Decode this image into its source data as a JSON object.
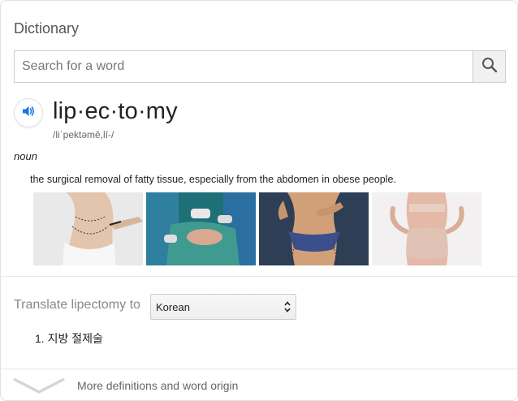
{
  "dictionary": {
    "title": "Dictionary",
    "search": {
      "placeholder": "Search for a word",
      "value": ""
    },
    "icons": {
      "search": "search-icon",
      "speaker": "speaker-icon",
      "expand": "chevron-down-icon"
    },
    "entry": {
      "headword": "lip·ec·to·my",
      "phonetic": "/liˈpektəmē,lī-/",
      "part_of_speech": "noun",
      "definition": "the surgical removal of fatty tissue, especially from the abdomen in obese people."
    },
    "images": [
      {
        "name": "image-marked-abdomen"
      },
      {
        "name": "image-surgery-team"
      },
      {
        "name": "image-torso-blue-underwear"
      },
      {
        "name": "image-back-view-beige"
      }
    ],
    "translate": {
      "label": "Translate lipectomy to",
      "selected_language": "Korean",
      "results": [
        "1. 지방 절제술"
      ]
    },
    "more_link": "More definitions and word origin"
  },
  "colors": {
    "speaker_blue": "#1a73e8",
    "border": "#dfe1e5",
    "muted_text": "#888888"
  }
}
